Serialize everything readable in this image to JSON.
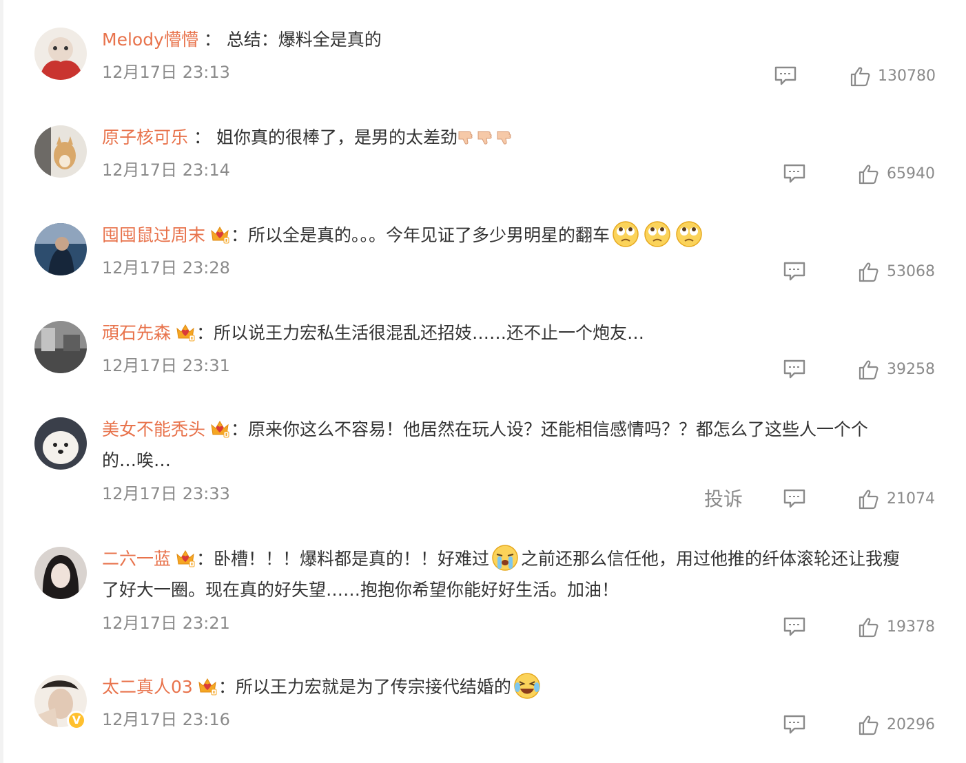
{
  "comments": [
    {
      "username": "Melody懵懵",
      "separator": "：",
      "text": "总结：爆料全是真的",
      "time": "12月17日 23:13",
      "likes": "130780",
      "avatar_color": "#c9342f"
    },
    {
      "username": "原子核可乐",
      "separator": "：",
      "text": "姐你真的很棒了，是男的太差劲",
      "time": "12月17日 23:14",
      "likes": "65940",
      "avatar_color": "#b8a589"
    },
    {
      "username": "囤囤鼠过周末",
      "separator": "：",
      "text": "所以全是真的。。。今年见证了多少男明星的翻车",
      "time": "12月17日 23:28",
      "likes": "53068",
      "avatar_color": "#2d4d6e"
    },
    {
      "username": "頑石先森",
      "separator": "：",
      "text": "所以说王力宏私生活很混乱还招妓……还不止一个炮友…",
      "time": "12月17日 23:31",
      "likes": "39258",
      "avatar_color": "#6b6b6b"
    },
    {
      "username": "美女不能秃头",
      "separator": "：",
      "text": "原来你这么不容易！他居然在玩人设？还能相信感情吗？？都怎么了这些人一个个",
      "text2": "的…唉…",
      "time": "12月17日 23:33",
      "report": "投诉",
      "likes": "21074",
      "avatar_color": "#3a3f4a"
    },
    {
      "username": "二六一蓝",
      "separator": "：",
      "text": "卧槽！！！爆料都是真的！！好难过",
      "text_after_emoji": "之前还那么信任他，用过他推的纤体滚轮还让我瘦",
      "text2": "了好大一圈。现在真的好失望……抱抱你希望你能好好生活。加油！",
      "time": "12月17日 23:21",
      "likes": "19378",
      "avatar_color": "#d9d3cf"
    },
    {
      "username": "太二真人03",
      "separator": "：",
      "text": "所以王力宏就是为了传宗接代结婚的",
      "time": "12月17日 23:16",
      "likes": "20296",
      "avatar_color": "#e2c9b5",
      "verified_mark": "V"
    }
  ],
  "colors": {
    "username": "#e8734c",
    "text": "#333333",
    "meta": "#8a8a8a",
    "crown": "#f5a623",
    "verified": "#ffc02e"
  },
  "icons": {
    "reply": "comment-bubble-icon",
    "like": "thumbs-up-icon",
    "crown": "vip-crown-badge-icon",
    "thumbs_down": "thumbs-down-emoji",
    "emoji_rolling_eyes": "rolling-eyes-emoji",
    "emoji_crying": "crying-emoji",
    "emoji_laughing": "laughing-crying-emoji"
  }
}
